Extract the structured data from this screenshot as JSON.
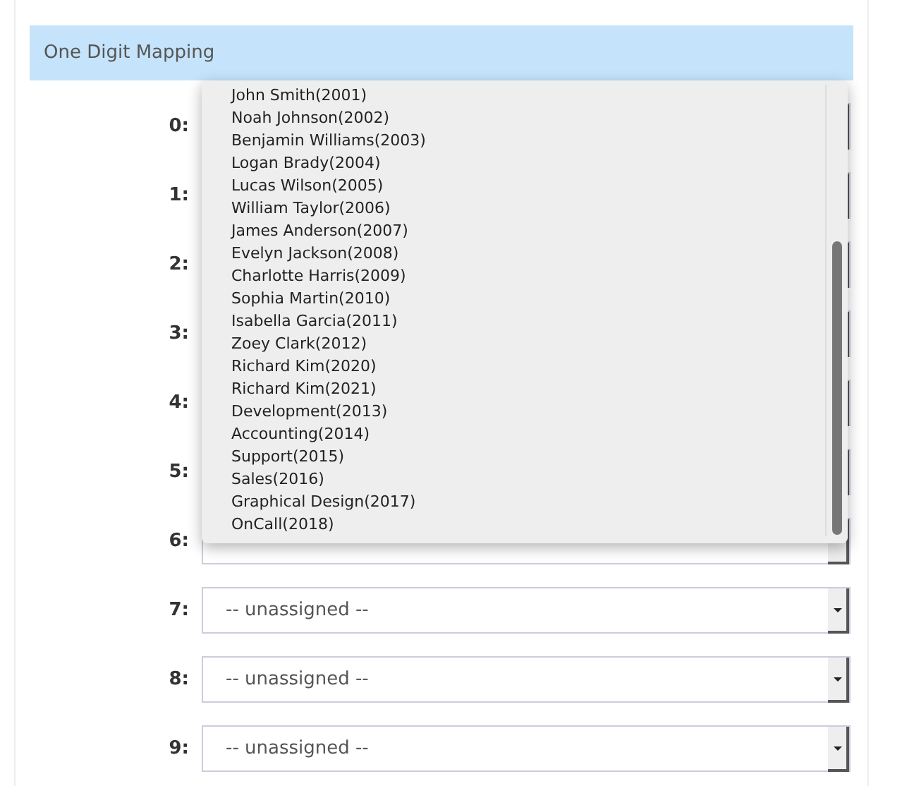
{
  "panel": {
    "title": "One Digit Mapping"
  },
  "mappings": [
    {
      "label": "0:"
    },
    {
      "label": "1:"
    },
    {
      "label": "2:"
    },
    {
      "label": "3:"
    },
    {
      "label": "4:"
    },
    {
      "label": "5:"
    },
    {
      "label": "6:"
    },
    {
      "label": "7:",
      "value": "-- unassigned --"
    },
    {
      "label": "8:",
      "value": "-- unassigned --"
    },
    {
      "label": "9:",
      "value": "-- unassigned --"
    }
  ],
  "open_dropdown": {
    "options": [
      "John Smith(2001)",
      "Noah Johnson(2002)",
      "Benjamin Williams(2003)",
      "Logan Brady(2004)",
      "Lucas Wilson(2005)",
      "William Taylor(2006)",
      "James Anderson(2007)",
      "Evelyn Jackson(2008)",
      "Charlotte Harris(2009)",
      "Sophia Martin(2010)",
      "Isabella Garcia(2011)",
      "Zoey Clark(2012)",
      "Richard Kim(2020)",
      "Richard Kim(2021)",
      "Development(2013)",
      "Accounting(2014)",
      "Support(2015)",
      "Sales(2016)",
      "Graphical Design(2017)",
      "OnCall(2018)"
    ]
  }
}
